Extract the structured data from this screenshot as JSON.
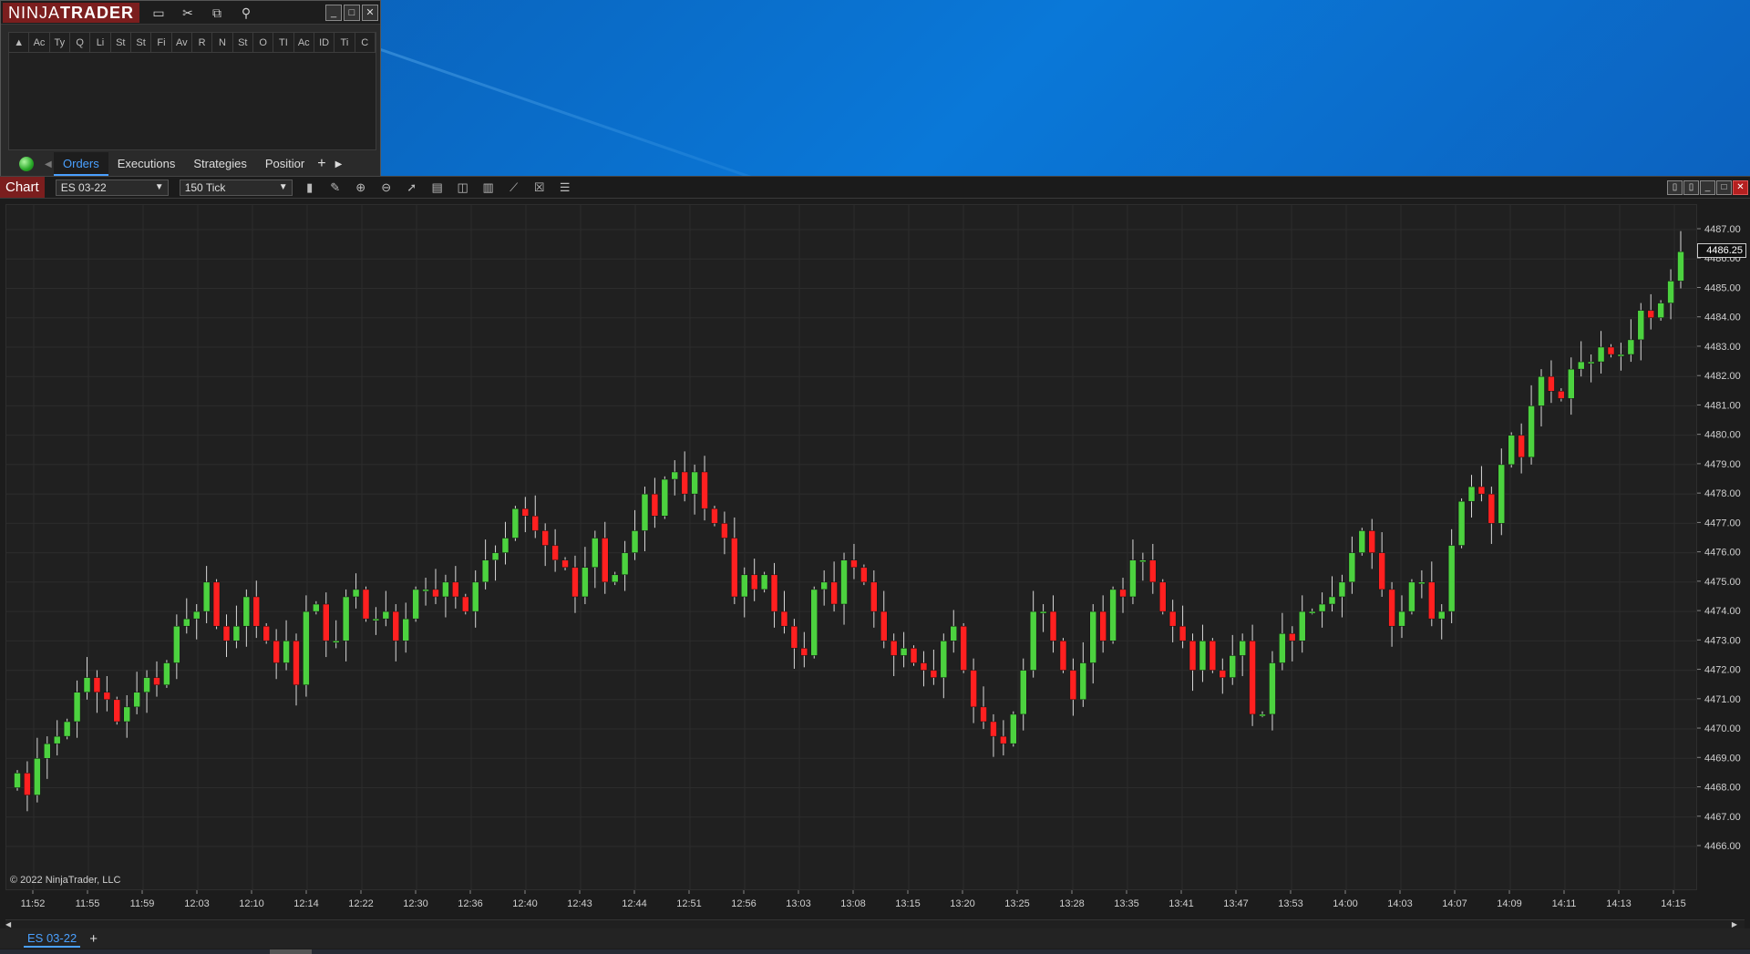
{
  "control_center": {
    "logo_a": "NINJA",
    "logo_b": "TRADER",
    "columns": [
      "▲",
      "Ac",
      "Ty",
      "Q",
      "Li",
      "St",
      "St",
      "Fi",
      "Av",
      "R",
      "N",
      "St",
      "O",
      "TI",
      "Ac",
      "ID",
      "Ti",
      "C"
    ],
    "tabs": [
      "Orders",
      "Executions",
      "Strategies",
      "Positior"
    ],
    "active_tab": "Orders"
  },
  "chart": {
    "label": "Chart",
    "instrument": "ES 03-22",
    "interval": "150 Tick",
    "copyright": "© 2022 NinjaTrader, LLC",
    "last_price": "4486.25",
    "bottom_tab": "ES 03-22",
    "up_color": "#4cd23f",
    "down_color": "#ff2020",
    "price_labels": [
      "4487.00",
      "4486.00",
      "4485.00",
      "4484.00",
      "4483.00",
      "4482.00",
      "4481.00",
      "4480.00",
      "4479.00",
      "4478.00",
      "4477.00",
      "4476.00",
      "4475.00",
      "4474.00",
      "4473.00",
      "4472.00",
      "4471.00",
      "4470.00",
      "4469.00",
      "4468.00",
      "4467.00",
      "4466.00"
    ],
    "time_labels": [
      "11:52",
      "11:55",
      "11:59",
      "12:03",
      "12:10",
      "12:14",
      "12:22",
      "12:30",
      "12:36",
      "12:40",
      "12:43",
      "12:44",
      "12:51",
      "12:56",
      "13:03",
      "13:08",
      "13:15",
      "13:20",
      "13:25",
      "13:28",
      "13:35",
      "13:41",
      "13:47",
      "13:53",
      "14:00",
      "14:03",
      "14:07",
      "14:09",
      "14:11",
      "14:13",
      "14:15"
    ]
  },
  "chart_data": {
    "type": "candlestick",
    "ylim": [
      4466,
      4487.5
    ],
    "closes": [
      4468.5,
      4467.75,
      4469,
      4469.5,
      4469.75,
      4470.25,
      4471.25,
      4471.75,
      4471.25,
      4471,
      4470.25,
      4470.75,
      4471.25,
      4471.75,
      4471.5,
      4472.25,
      4473.5,
      4473.75,
      4474,
      4475,
      4473.5,
      4473,
      4473.5,
      4474.5,
      4473.5,
      4473,
      4472.25,
      4473,
      4471.5,
      4474,
      4474.25,
      4473,
      4473,
      4474.5,
      4474.75,
      4473.75,
      4473.75,
      4474,
      4473,
      4473.75,
      4474.75,
      4474.75,
      4474.5,
      4475,
      4474.5,
      4474,
      4475,
      4475.75,
      4476,
      4476.5,
      4477.5,
      4477.25,
      4476.75,
      4476.25,
      4475.75,
      4475.5,
      4474.5,
      4475.5,
      4476.5,
      4475,
      4475.25,
      4476,
      4476.75,
      4478,
      4477.25,
      4478.5,
      4478.75,
      4478,
      4478.75,
      4477.5,
      4477,
      4476.5,
      4474.5,
      4475.25,
      4474.75,
      4475.25,
      4474,
      4473.5,
      4472.75,
      4472.5,
      4474.75,
      4475,
      4474.25,
      4475.75,
      4475.5,
      4475,
      4474,
      4473,
      4472.5,
      4472.75,
      4472.25,
      4472,
      4471.75,
      4473,
      4473.5,
      4472,
      4470.75,
      4470.25,
      4469.75,
      4469.5,
      4470.5,
      4472,
      4474,
      4474,
      4473,
      4472,
      4471,
      4472.25,
      4474,
      4473,
      4474.75,
      4474.5,
      4475.75,
      4475.75,
      4475,
      4474,
      4473.5,
      4473,
      4472,
      4473,
      4472,
      4471.75,
      4472.5,
      4473,
      4470.5,
      4470.5,
      4472.25,
      4473.25,
      4473,
      4474,
      4474,
      4474.25,
      4474.5,
      4475,
      4476,
      4476.75,
      4476,
      4474.75,
      4473.5,
      4474,
      4475,
      4475,
      4473.75,
      4474,
      4476.25,
      4477.75,
      4478.25,
      4478,
      4477,
      4479,
      4480,
      4479.25,
      4481,
      4482,
      4481.5,
      4481.25,
      4482.25,
      4482.5,
      4482.5,
      4483,
      4482.75,
      4482.75,
      4483.25,
      4484.25,
      4484,
      4484.5,
      4485.25,
      4486.25
    ]
  }
}
